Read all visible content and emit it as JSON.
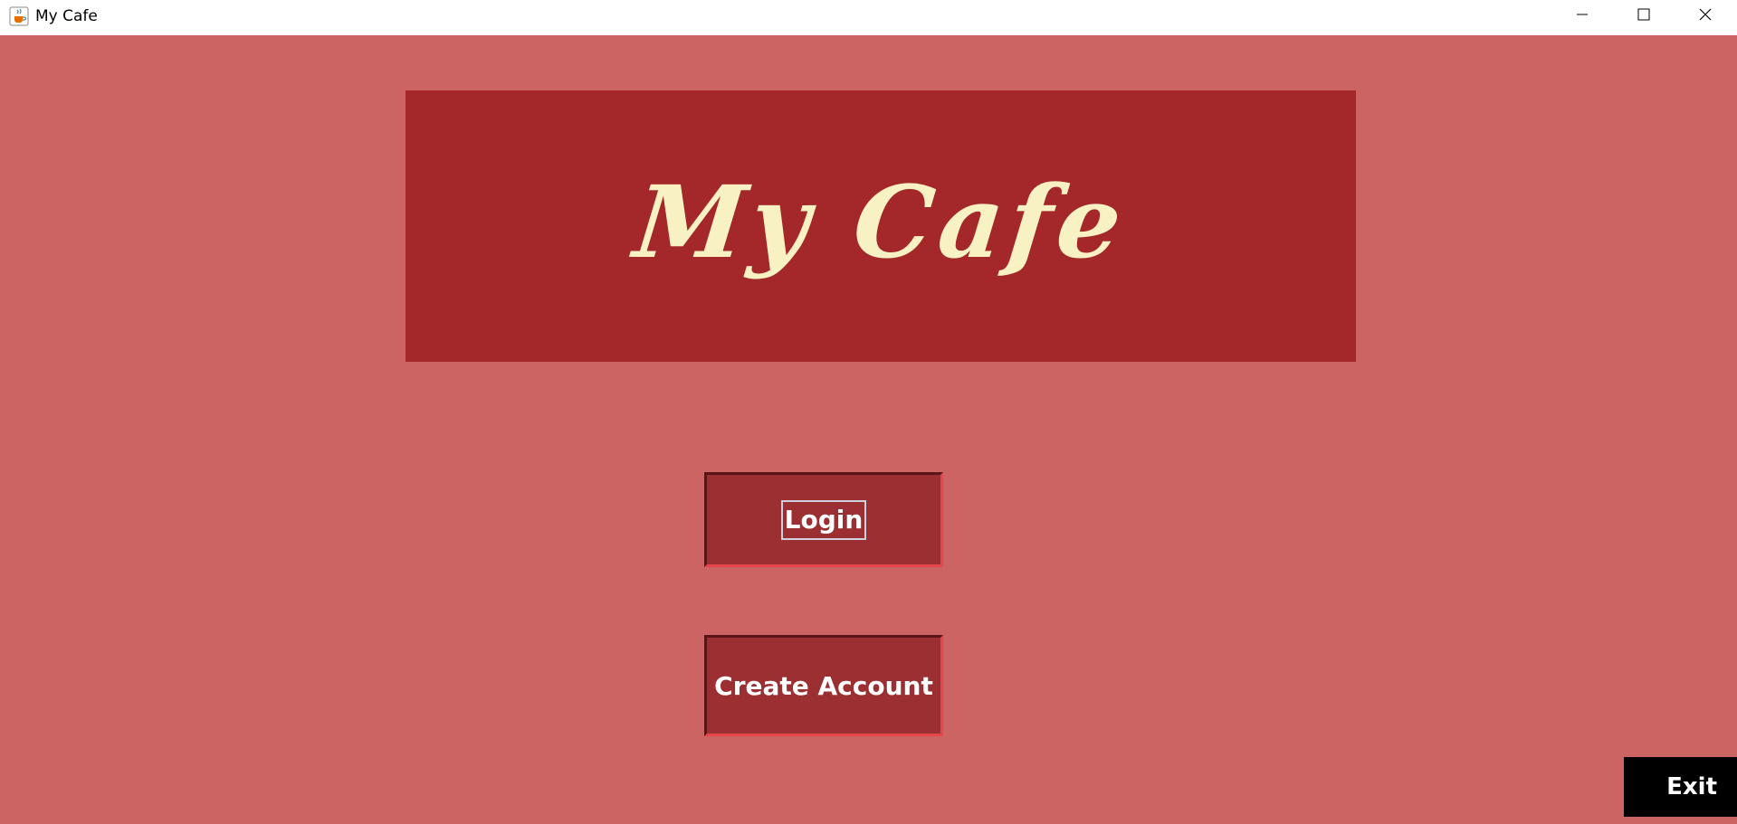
{
  "window": {
    "title": "My Cafe",
    "icon": "java-cup-icon",
    "controls": {
      "minimize_icon": "minimize-icon",
      "maximize_icon": "maximize-icon",
      "close_icon": "close-icon"
    }
  },
  "banner": {
    "title": "My Cafe"
  },
  "buttons": {
    "login_label": "Login",
    "create_account_label": "Create Account",
    "exit_label": "Exit"
  },
  "colors": {
    "background": "#cc6464",
    "banner": "#a4272a",
    "banner_text": "#f7f1c4",
    "button": "#9b2f31",
    "exit_button": "#000000"
  }
}
